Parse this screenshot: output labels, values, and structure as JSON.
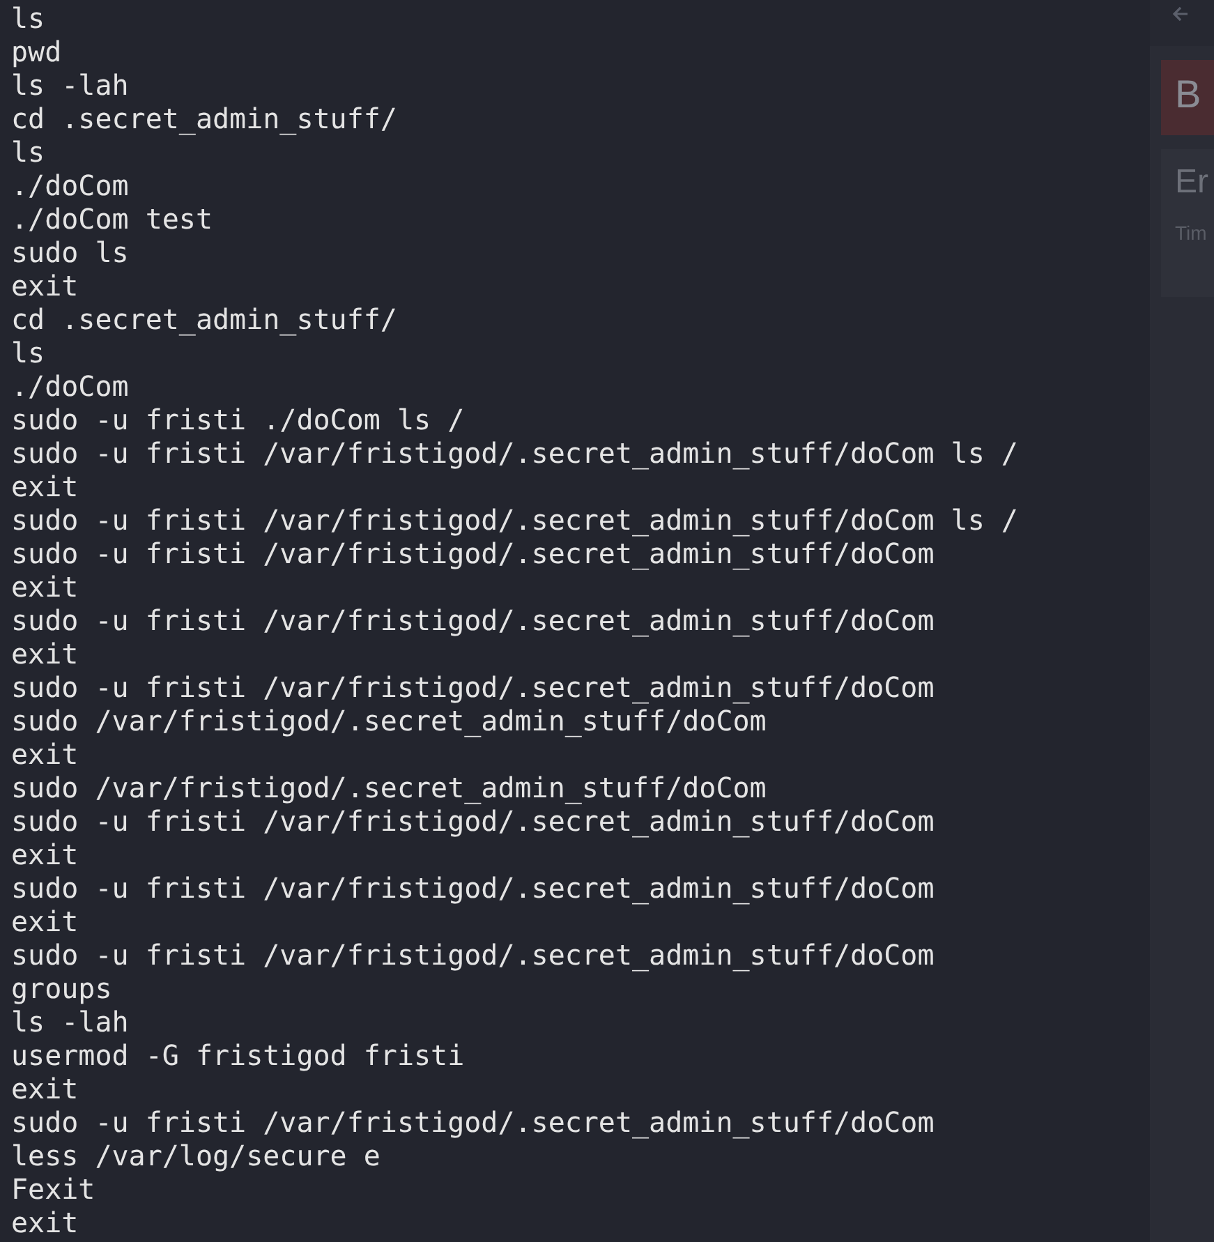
{
  "terminal": {
    "lines": [
      "ls",
      "pwd",
      "ls -lah",
      "cd .secret_admin_stuff/",
      "ls",
      "./doCom",
      "./doCom test",
      "sudo ls",
      "exit",
      "cd .secret_admin_stuff/",
      "ls",
      "./doCom",
      "sudo -u fristi ./doCom ls /",
      "sudo -u fristi /var/fristigod/.secret_admin_stuff/doCom ls /",
      "exit",
      "sudo -u fristi /var/fristigod/.secret_admin_stuff/doCom ls /",
      "sudo -u fristi /var/fristigod/.secret_admin_stuff/doCom",
      "exit",
      "sudo -u fristi /var/fristigod/.secret_admin_stuff/doCom",
      "exit",
      "sudo -u fristi /var/fristigod/.secret_admin_stuff/doCom",
      "sudo /var/fristigod/.secret_admin_stuff/doCom",
      "exit",
      "sudo /var/fristigod/.secret_admin_stuff/doCom",
      "sudo -u fristi /var/fristigod/.secret_admin_stuff/doCom",
      "exit",
      "sudo -u fristi /var/fristigod/.secret_admin_stuff/doCom",
      "exit",
      "sudo -u fristi /var/fristigod/.secret_admin_stuff/doCom",
      "groups",
      "ls -lah",
      "usermod -G fristigod fristi",
      "exit",
      "sudo -u fristi /var/fristigod/.secret_admin_stuff/doCom",
      "less /var/log/secure e",
      "Fexit",
      "exit"
    ]
  },
  "browser": {
    "banner": "B",
    "heading": "Er",
    "subtext": "Tim"
  }
}
